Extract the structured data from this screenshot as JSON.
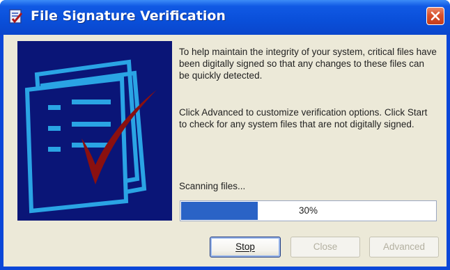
{
  "window": {
    "title": "File Signature Verification"
  },
  "content": {
    "intro_text": "To help maintain the integrity of your system, critical files have been digitally signed so that any changes to these files can be quickly detected.",
    "instructions_text": "Click Advanced to customize verification options. Click Start to check for any system files that are not digitally signed."
  },
  "progress": {
    "label": "Scanning files...",
    "percent": 30,
    "percent_text": "30%"
  },
  "buttons": {
    "stop_label": "Stop",
    "close_label": "Close",
    "advanced_label": "Advanced"
  },
  "colors": {
    "titlebar": "#0a4fd9",
    "client_bg": "#ece9d8",
    "progress_fill": "#2a63c6",
    "art_bg": "#0a1577",
    "checkmark": "#8a1010"
  },
  "icons": {
    "title": "signature-verification-icon",
    "close": "close-icon",
    "illustration": "document-checkmark-illustration"
  }
}
